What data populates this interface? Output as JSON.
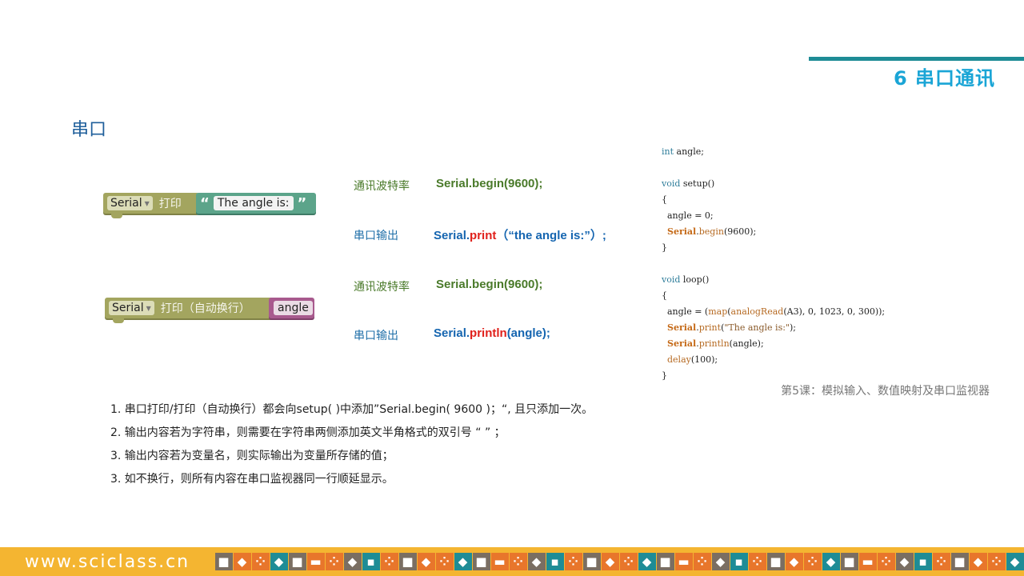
{
  "chapter_title": "6 串口通讯",
  "section_title": "串口",
  "blocks": {
    "block1": {
      "dropdown": "Serial",
      "label": "打印",
      "text": "The angle is:"
    },
    "block2": {
      "dropdown": "Serial",
      "label": "打印（自动换行）",
      "variable": "angle"
    }
  },
  "explanations": [
    {
      "label": "通讯波特率",
      "code": "Serial.begin(9600);"
    },
    {
      "label": "串口输出",
      "code_prefix": "Serial.",
      "code_method": "print",
      "code_suffix": "（“the angle is:”）;"
    },
    {
      "label": "通讯波特率",
      "code": "Serial.begin(9600);"
    },
    {
      "label": "串口输出",
      "code_prefix": "Serial.",
      "code_method": "println",
      "code_suffix": "(angle);"
    }
  ],
  "code": {
    "line1": "int angle;",
    "line2": "void setup()",
    "line3": "{",
    "line4": "  angle = 0;",
    "line5": "  Serial.begin(9600);",
    "line6": "}",
    "line7": "void loop()",
    "line8": "{",
    "line9": "  angle = (map(analogRead(A3), 0, 1023, 0, 300));",
    "line10": "  Serial.print(\"The angle is:\");",
    "line11": "  Serial.println(angle);",
    "line12": "  delay(100);",
    "line13": "}"
  },
  "caption": "第5课：模拟输入、数值映射及串口监视器",
  "notes": [
    "1. 串口打印/打印（自动换行）都会向setup( )中添加”Serial.begin( 9600 )；“, 且只添加一次。",
    "2. 输出内容若为字符串，则需要在字符串两侧添加英文半角格式的双引号 “ ” ；",
    "3. 输出内容若为变量名，则实际输出为变量所存储的值；",
    "3. 如不换行，则所有内容在串口监视器同一行顺延显示。"
  ],
  "footer": {
    "brand": "www.sciclass.cn"
  },
  "colors": {
    "accent": "#1aa5d6",
    "footer_bg": "#f4b531",
    "block_serial": "#a3a55f",
    "block_text": "#5ca48a",
    "block_var": "#a85a8e"
  }
}
